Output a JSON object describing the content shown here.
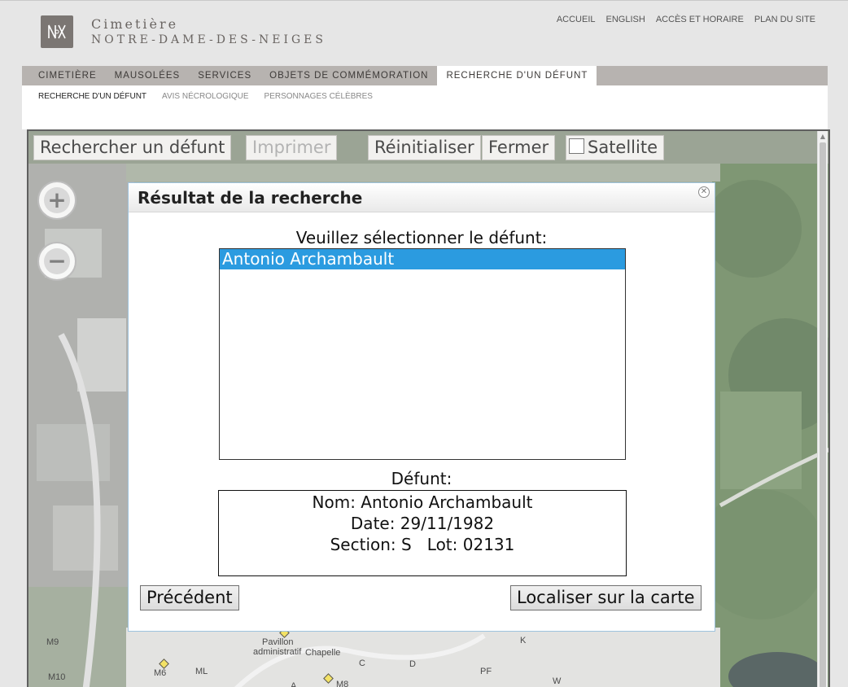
{
  "header": {
    "logo_line1": "Cimetière",
    "logo_line2": "NOTRE-DAME-DES-NEIGES",
    "top_links": [
      "ACCUEIL",
      "ENGLISH",
      "ACCÈS ET HORAIRE",
      "PLAN DU SITE"
    ]
  },
  "nav": {
    "items": [
      "CIMETIÈRE",
      "MAUSOLÉES",
      "SERVICES",
      "OBJETS DE COMMÉMORATION",
      "RECHERCHE D'UN DÉFUNT"
    ],
    "active_index": 4
  },
  "subnav": {
    "items": [
      "RECHERCHE D'UN DÉFUNT",
      "AVIS NÉCROLOGIQUE",
      "PERSONNAGES CÉLÈBRES"
    ],
    "active_index": 0
  },
  "toolbar": {
    "search_label": "Rechercher un défunt",
    "print_label": "Imprimer",
    "reset_label": "Réinitialiser",
    "close_label": "Fermer",
    "satellite_label": "Satellite",
    "satellite_checked": false
  },
  "map": {
    "zoom_in_icon": "plus-icon",
    "zoom_out_icon": "minus-icon",
    "labels": [
      "M9",
      "M10",
      "M6",
      "ML",
      "Pavillon",
      "administratif",
      "Chapelle",
      "C",
      "D",
      "K",
      "PF",
      "W",
      "A",
      "M8"
    ]
  },
  "dialog": {
    "title": "Résultat de la recherche",
    "prompt": "Veuillez sélectionner le défunt:",
    "results": [
      "Antonio Archambault"
    ],
    "selected_index": 0,
    "defunt_label": "Défunt:",
    "info": {
      "name_line": "Nom: Antonio Archambault",
      "date_line": "Date: 29/11/1982",
      "section_line": "Section: S   Lot: 02131"
    },
    "prev_button": "Précédent",
    "locate_button": "Localiser sur la carte"
  },
  "colors": {
    "nav_bg": "#b7b3b0",
    "selection": "#2b9be0",
    "dialog_border": "#9ec3de"
  }
}
